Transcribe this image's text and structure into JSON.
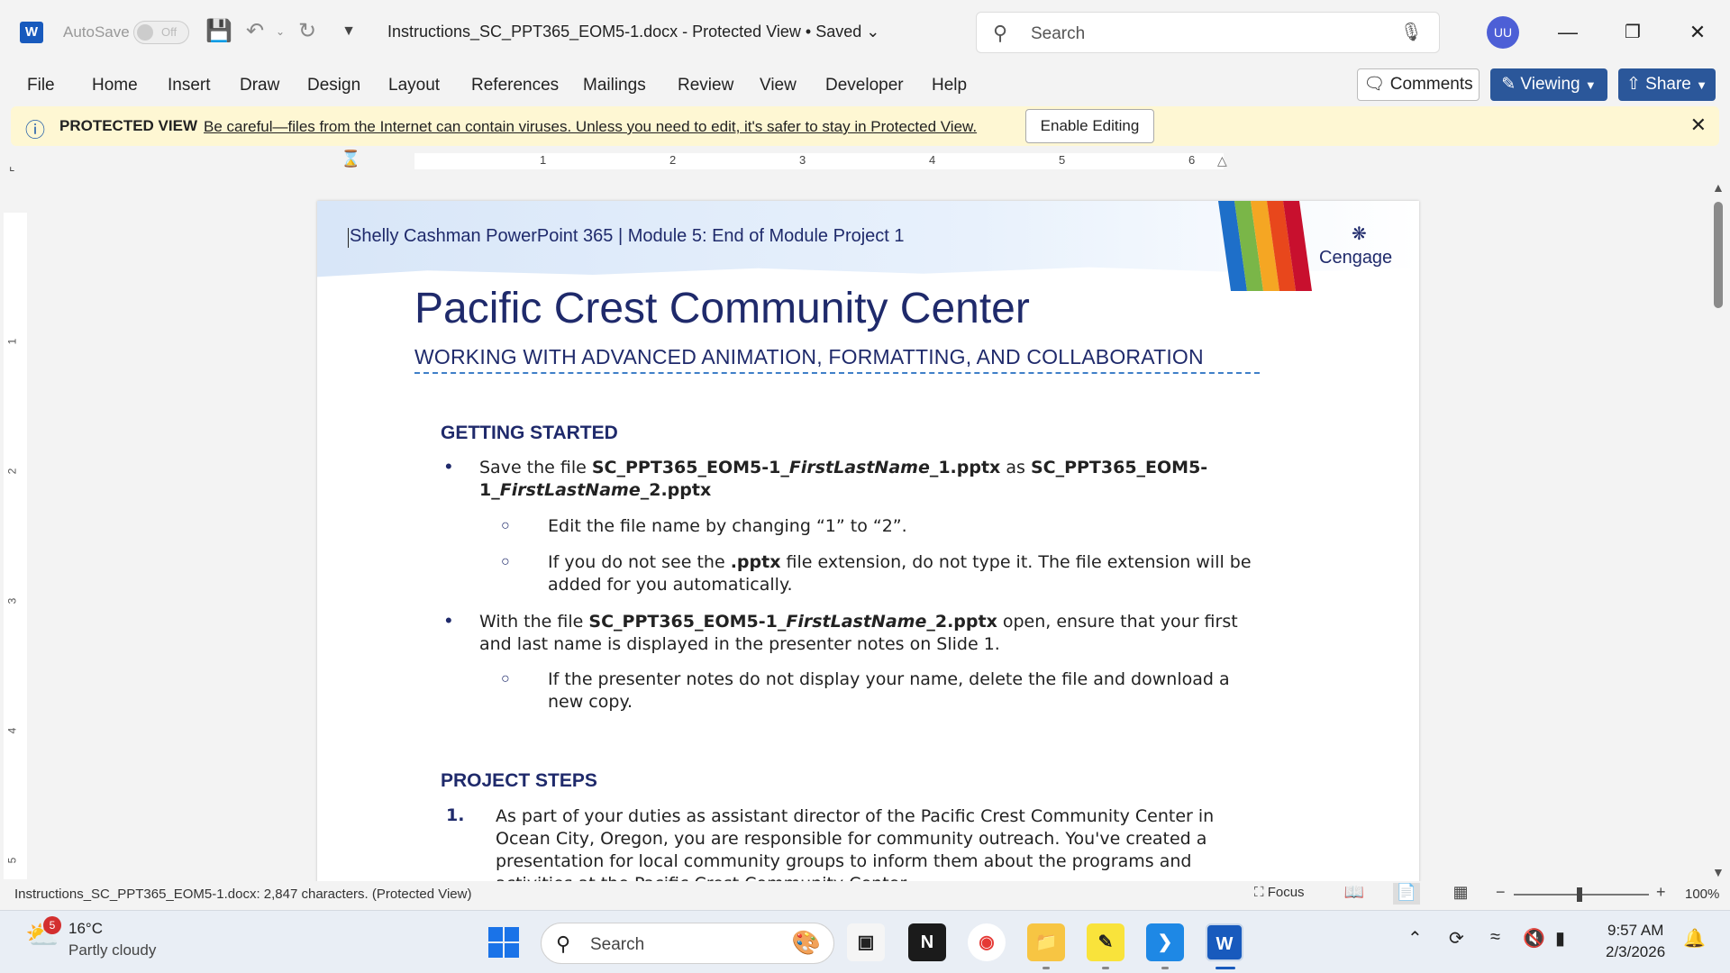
{
  "titlebar": {
    "app_logo": "W",
    "autosave_label": "AutoSave",
    "autosave_state": "Off",
    "doc_title": "Instructions_SC_PPT365_EOM5-1.docx  -  Protected View • Saved ⌄",
    "search_placeholder": "Search",
    "user_initials": "UU"
  },
  "menu": {
    "items": [
      "File",
      "Home",
      "Insert",
      "Draw",
      "Design",
      "Layout",
      "References",
      "Mailings",
      "Review",
      "View",
      "Developer",
      "Help"
    ],
    "comments_label": "Comments",
    "viewing_label": "Viewing",
    "share_label": "Share"
  },
  "protected_view": {
    "label": "PROTECTED VIEW",
    "message": "Be careful—files from the Internet can contain viruses. Unless you need to edit, it's safer to stay in Protected View.",
    "enable_button": "Enable Editing"
  },
  "ruler": {
    "numbers": [
      "1",
      "2",
      "3",
      "4",
      "5",
      "6"
    ],
    "vertical_numbers": [
      "1",
      "2",
      "3",
      "4",
      "5"
    ]
  },
  "document": {
    "header_text": "Shelly Cashman PowerPoint 365 | Module 5: End of Module Project 1",
    "brand": "Cengage",
    "title": "Pacific Crest Community Center",
    "subtitle": "WORKING WITH ADVANCED ANIMATION, FORMATTING, AND COLLABORATION",
    "section1_heading": "GETTING STARTED",
    "b1_pre": "Save the file ",
    "b1_f1a": "SC_PPT365_EOM5-1_",
    "b1_f1b": "FirstLastName",
    "b1_f1c": "_1.pptx",
    "b1_mid": " as ",
    "b1_f2a": "SC_PPT365_EOM5-",
    "b1_f2b": "1_",
    "b1_f2c": "FirstLastName",
    "b1_f2d": "_2.pptx",
    "sub1": "Edit the file name by changing “1” to “2”.",
    "sub2_pre": "If you do not see the ",
    "sub2_bold": ".pptx",
    "sub2_post_l1": " file extension, do not type it. The file extension will be",
    "sub2_l2": "added for you automatically.",
    "b2_pre": "With the file ",
    "b2_fa": "SC_PPT365_EOM5-1_",
    "b2_fb": "FirstLastName",
    "b2_fc": "_2.pptx",
    "b2_post_l1": " open, ensure that your first",
    "b2_l2": "and last name is displayed in the presenter notes on Slide 1.",
    "sub3_l1": "If the presenter notes do not display your name, delete the file and download a",
    "sub3_l2": "new copy.",
    "section2_heading": "PROJECT STEPS",
    "step1_num": "1.",
    "step1_l1": "As part of your duties as assistant director of the Pacific Crest Community Center in",
    "step1_l2": "Ocean City, Oregon, you are responsible for community outreach. You've created a",
    "step1_l3": "presentation for local community groups to inform them about the programs and",
    "step1_l4": "activities at the Pacific Crest Community Center."
  },
  "statusbar": {
    "info": "Instructions_SC_PPT365_EOM5-1.docx: 2,847 characters.  (Protected View)",
    "focus_label": "Focus",
    "zoom": "100%"
  },
  "taskbar": {
    "weather_badge": "5",
    "temperature": "16°C",
    "condition": "Partly cloudy",
    "search_placeholder": "Search",
    "time": "9:57 AM",
    "date": "2/3/2026"
  },
  "colors": {
    "accent": "#2b579a",
    "doc_heading": "#1f2a6b",
    "protected_bg": "#fef7d3"
  }
}
